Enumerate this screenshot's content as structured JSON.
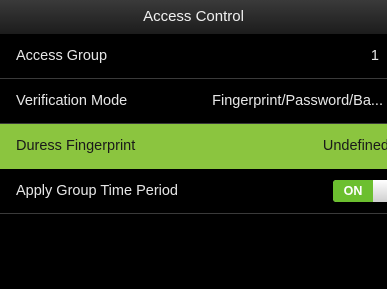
{
  "header": {
    "title": "Access Control"
  },
  "settings": [
    {
      "label": "Access Group",
      "value": "1"
    },
    {
      "label": "Verification Mode",
      "value": "Fingerprint/Password/Ba..."
    },
    {
      "label": "Duress Fingerprint",
      "value": "Undefined"
    },
    {
      "label": "Apply Group Time Period",
      "toggle": "ON"
    }
  ],
  "colors": {
    "selected_row": "#8bc53f",
    "toggle_on": "#6cbf2f",
    "background": "#000000"
  }
}
